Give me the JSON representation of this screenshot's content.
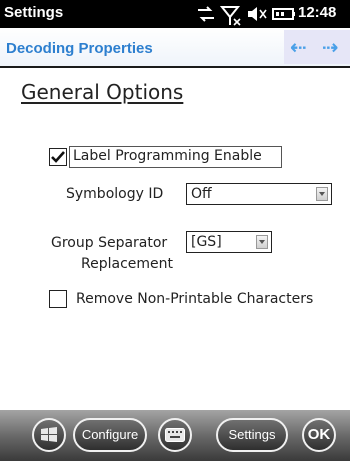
{
  "status_bar": {
    "title": "Settings",
    "clock": "12:48",
    "icons": [
      "connection-icon",
      "no-signal-icon",
      "volume-icon",
      "battery-icon"
    ]
  },
  "header": {
    "title": "Decoding Properties",
    "back_icon": "left-arrow-icon",
    "forward_icon": "right-arrow-icon"
  },
  "content": {
    "section_title": "General Options",
    "label_programming": {
      "label": "Label Programming Enable",
      "checked": true
    },
    "symbology_id": {
      "label": "Symbology ID",
      "value": "Off"
    },
    "group_separator": {
      "label_line1": "Group Separator",
      "label_line2": "Replacement",
      "value": "[GS]"
    },
    "remove_nonprintable": {
      "label": "Remove Non-Printable Characters",
      "checked": false
    }
  },
  "toolbar": {
    "start_icon": "windows-start-icon",
    "configure_label": "Configure",
    "keyboard_icon": "keyboard-icon",
    "settings_label": "Settings",
    "ok_label": "OK"
  }
}
